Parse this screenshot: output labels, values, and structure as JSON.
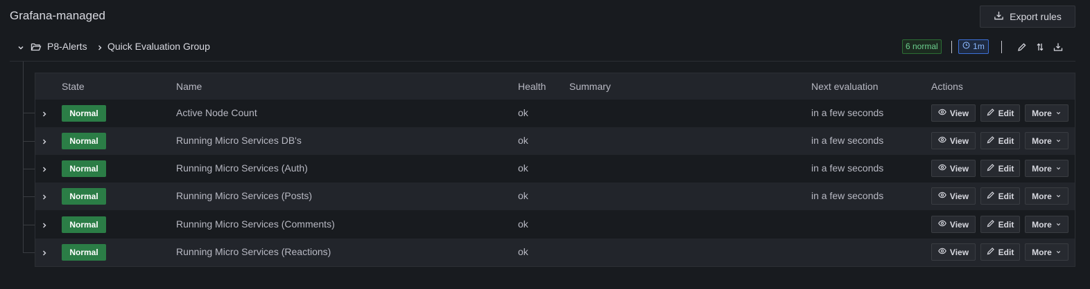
{
  "page": {
    "title": "Grafana-managed",
    "export_label": "Export rules"
  },
  "group": {
    "folder": "P8-Alerts",
    "name": "Quick Evaluation Group",
    "state_summary": "6 normal",
    "interval": "1m"
  },
  "table": {
    "headers": {
      "state": "State",
      "name": "Name",
      "health": "Health",
      "summary": "Summary",
      "next_evaluation": "Next evaluation",
      "actions": "Actions"
    },
    "rows": [
      {
        "state": "Normal",
        "name": "Active Node Count",
        "health": "ok",
        "summary": "",
        "next_evaluation": "in a few seconds"
      },
      {
        "state": "Normal",
        "name": "Running Micro Services DB's",
        "health": "ok",
        "summary": "",
        "next_evaluation": "in a few seconds"
      },
      {
        "state": "Normal",
        "name": "Running Micro Services (Auth)",
        "health": "ok",
        "summary": "",
        "next_evaluation": "in a few seconds"
      },
      {
        "state": "Normal",
        "name": "Running Micro Services (Posts)",
        "health": "ok",
        "summary": "",
        "next_evaluation": "in a few seconds"
      },
      {
        "state": "Normal",
        "name": "Running Micro Services (Comments)",
        "health": "ok",
        "summary": "",
        "next_evaluation": ""
      },
      {
        "state": "Normal",
        "name": "Running Micro Services (Reactions)",
        "health": "ok",
        "summary": "",
        "next_evaluation": ""
      }
    ],
    "actions": {
      "view": "View",
      "edit": "Edit",
      "more": "More"
    }
  },
  "colors": {
    "background": "#181b1f",
    "state_normal": "#2b7d46",
    "badge_normal_text": "#6ccf8e",
    "interval_accent": "#3d71d9"
  },
  "icons": {
    "export": "download-icon",
    "group_toggle": "chevron-down-icon",
    "folder": "folder-open-icon",
    "breadcrumb_separator": "chevron-right-icon",
    "interval": "clock-icon",
    "edit_group": "pencil-icon",
    "reorder": "exchange-icon",
    "export_group": "download-icon",
    "row_expand": "chevron-right-icon",
    "view": "eye-icon",
    "edit": "pencil-icon",
    "more": "chevron-down-icon"
  }
}
